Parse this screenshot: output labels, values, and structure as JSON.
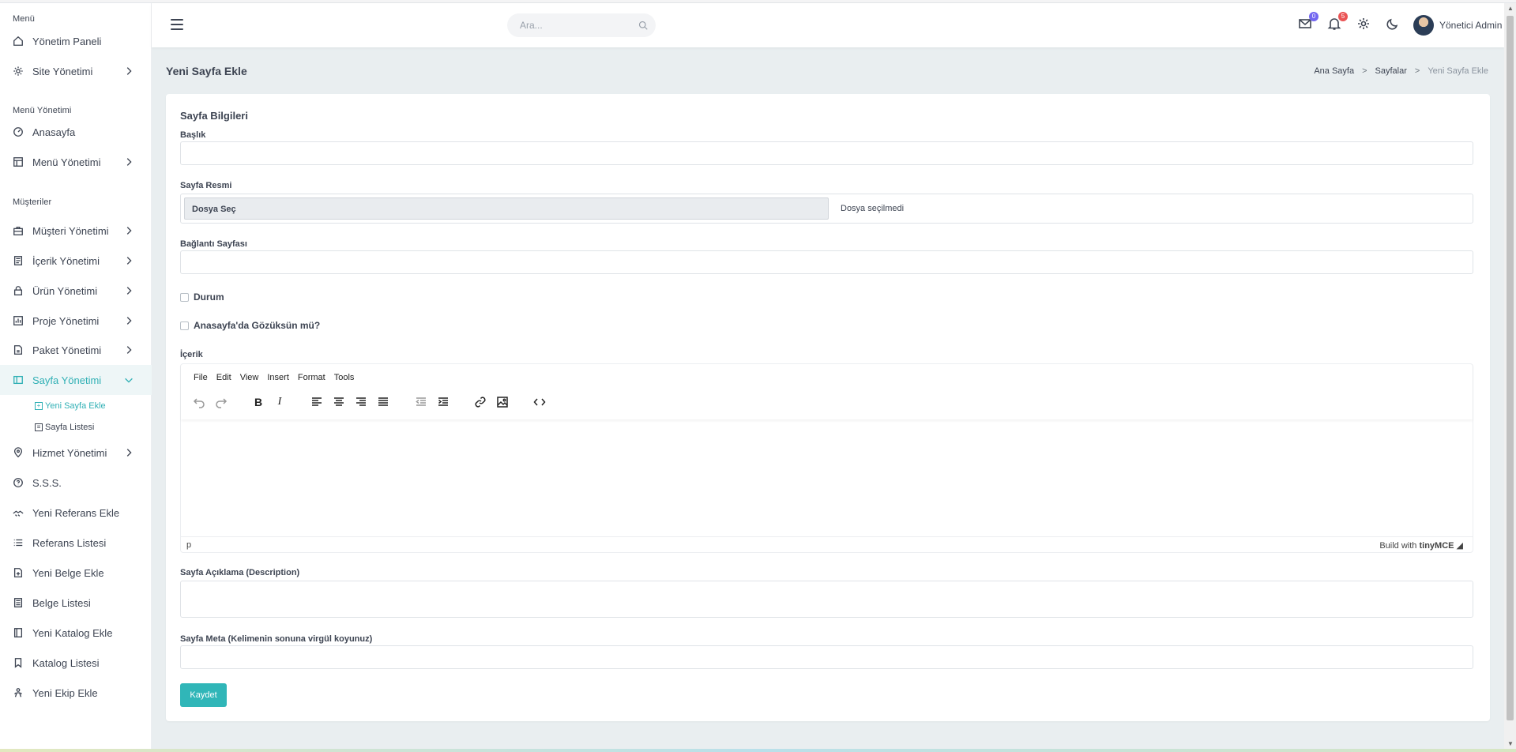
{
  "sidebar": {
    "sections": {
      "menu": "Menü",
      "menu_management": "Menü Yönetimi",
      "customers": "Müşteriler"
    },
    "items": [
      {
        "label": "Yönetim Paneli"
      },
      {
        "label": "Site Yönetimi"
      },
      {
        "label": "Anasayfa"
      },
      {
        "label": "Menü Yönetimi"
      },
      {
        "label": "Müşteri Yönetimi"
      },
      {
        "label": "İçerik Yönetimi"
      },
      {
        "label": "Ürün Yönetimi"
      },
      {
        "label": "Proje Yönetimi"
      },
      {
        "label": "Paket Yönetimi"
      },
      {
        "label": "Sayfa Yönetimi"
      },
      {
        "label": "Hizmet Yönetimi"
      },
      {
        "label": "S.S.S."
      },
      {
        "label": "Yeni Referans Ekle"
      },
      {
        "label": "Referans Listesi"
      },
      {
        "label": "Yeni Belge Ekle"
      },
      {
        "label": "Belge Listesi"
      },
      {
        "label": "Yeni Katalog Ekle"
      },
      {
        "label": "Katalog Listesi"
      },
      {
        "label": "Yeni Ekip Ekle"
      }
    ],
    "sub_items": [
      {
        "label": "Yeni Sayfa Ekle"
      },
      {
        "label": "Sayfa Listesi"
      }
    ]
  },
  "header": {
    "search_placeholder": "Ara...",
    "mail_count": "0",
    "notification_count": "5",
    "user_name": "Yönetici Admin"
  },
  "page": {
    "title": "Yeni Sayfa Ekle",
    "breadcrumbs": [
      "Ana Sayfa",
      "Sayfalar",
      "Yeni Sayfa Ekle"
    ]
  },
  "form": {
    "card_title": "Sayfa Bilgileri",
    "title_label": "Başlık",
    "image_label": "Sayfa Resmi",
    "file_button": "Dosya Seç",
    "file_status": "Dosya seçilmedi",
    "link_label": "Bağlantı Sayfası",
    "status_label": "Durum",
    "homepage_label": "Anasayfa'da Gözüksün mü?",
    "content_label": "İçerik",
    "description_label": "Sayfa Açıklama (Description)",
    "meta_label": "Sayfa Meta (Kelimenin sonuna virgül koyunuz)",
    "save_button": "Kaydet"
  },
  "editor": {
    "menu": [
      "File",
      "Edit",
      "View",
      "Insert",
      "Format",
      "Tools"
    ],
    "status_path": "p",
    "branding_prefix": "Build with",
    "branding_name": "tinyMCE"
  },
  "colors": {
    "accent": "#30b6b8",
    "mail_badge": "#7367f0",
    "notification_badge": "#ea5455"
  }
}
